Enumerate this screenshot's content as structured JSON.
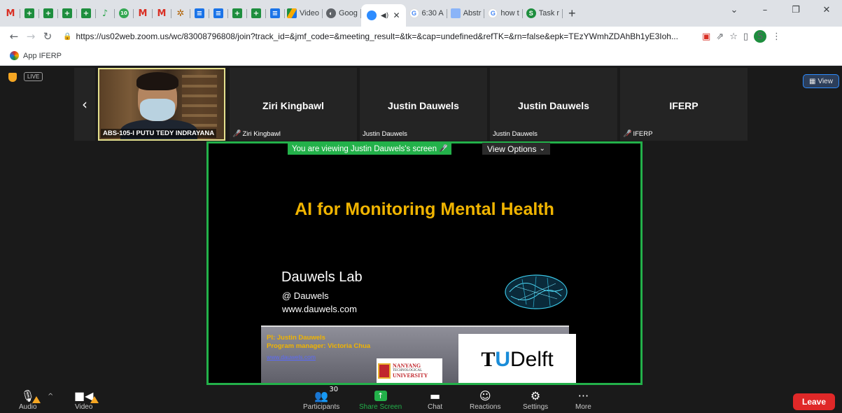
{
  "browser": {
    "tabs": [
      {
        "label": "",
        "icon": "gmail-icon"
      },
      {
        "label": "",
        "icon": "google-sheets-icon"
      },
      {
        "label": "",
        "icon": "google-sheets-icon"
      },
      {
        "label": "",
        "icon": "google-sheets-icon"
      },
      {
        "label": "",
        "icon": "google-sheets-icon"
      },
      {
        "label": "",
        "icon": "app-icon"
      },
      {
        "label": "",
        "icon": "app-icon"
      },
      {
        "label": "",
        "icon": "gmail-icon"
      },
      {
        "label": "",
        "icon": "gmail-icon"
      },
      {
        "label": "",
        "icon": "app-icon"
      },
      {
        "label": "",
        "icon": "google-docs-icon"
      },
      {
        "label": "",
        "icon": "google-docs-icon"
      },
      {
        "label": "",
        "icon": "google-sheets-icon"
      },
      {
        "label": "",
        "icon": "google-sheets-icon"
      },
      {
        "label": "",
        "icon": "google-docs-icon"
      }
    ],
    "labeled_tabs": [
      {
        "label": "Video",
        "icon": "google-drive-icon"
      },
      {
        "label": "Goog",
        "icon": "globe-icon"
      }
    ],
    "active_tab": {
      "label": "",
      "icon": "zoom-icon"
    },
    "after_tabs": [
      {
        "label": "6:30 A",
        "icon": "google-icon"
      },
      {
        "label": "Abstr",
        "icon": "document-icon"
      },
      {
        "label": "how t",
        "icon": "google-icon"
      },
      {
        "label": "Task r",
        "icon": "task-icon"
      }
    ],
    "new_tab": "+",
    "url": "https://us02web.zoom.us/wc/83008796808/join?track_id=&jmf_code=&meeting_result=&tk=&cap=undefined&refTK=&rn=false&epk=TEzYWmhZDAhBh1yE3Ioh...",
    "profile_initial": "S",
    "bookmark": "App IFERP"
  },
  "meeting": {
    "live_badge": "LIVE",
    "view_button": "View",
    "participants": [
      {
        "display": "",
        "label": "ABS-105-I PUTU TEDY INDRAYANA",
        "muted": false,
        "video": true
      },
      {
        "display": "Ziri Kingbawl",
        "label": "Ziri Kingbawl",
        "muted": true,
        "video": false
      },
      {
        "display": "Justin Dauwels",
        "label": "Justin Dauwels",
        "muted": false,
        "video": false
      },
      {
        "display": "Justin Dauwels",
        "label": "Justin Dauwels",
        "muted": false,
        "video": false
      },
      {
        "display": "IFERP",
        "label": "IFERP",
        "muted": true,
        "video": false
      }
    ],
    "share_banner": "You are viewing Justin Dauwels's screen",
    "view_options": "View Options"
  },
  "slide": {
    "title": "AI for Monitoring Mental Health",
    "lab": "Dauwels Lab",
    "handle": "@ Dauwels",
    "site": "www.dauwels.com",
    "pi": "PI: Justin Dauwels",
    "program_manager": "Program manager: Victoria Chua",
    "link": "www.dauwels.com",
    "ntu_line1": "NANYANG",
    "ntu_line2": "TECHNOLOGICAL",
    "ntu_line3": "UNIVERSITY",
    "tu_mark": "T",
    "tu_u": "U",
    "tu_rest": "Delft"
  },
  "toolbar": {
    "audio": "Audio",
    "video": "Video",
    "participants": "Participants",
    "participant_count": "30",
    "share": "Share Screen",
    "chat": "Chat",
    "reactions": "Reactions",
    "settings": "Settings",
    "more": "More",
    "leave": "Leave"
  },
  "colors": {
    "share_green": "#23b14a",
    "leave_red": "#e02828",
    "slide_title": "#f0b400",
    "zoom_blue": "#2d8cff"
  }
}
